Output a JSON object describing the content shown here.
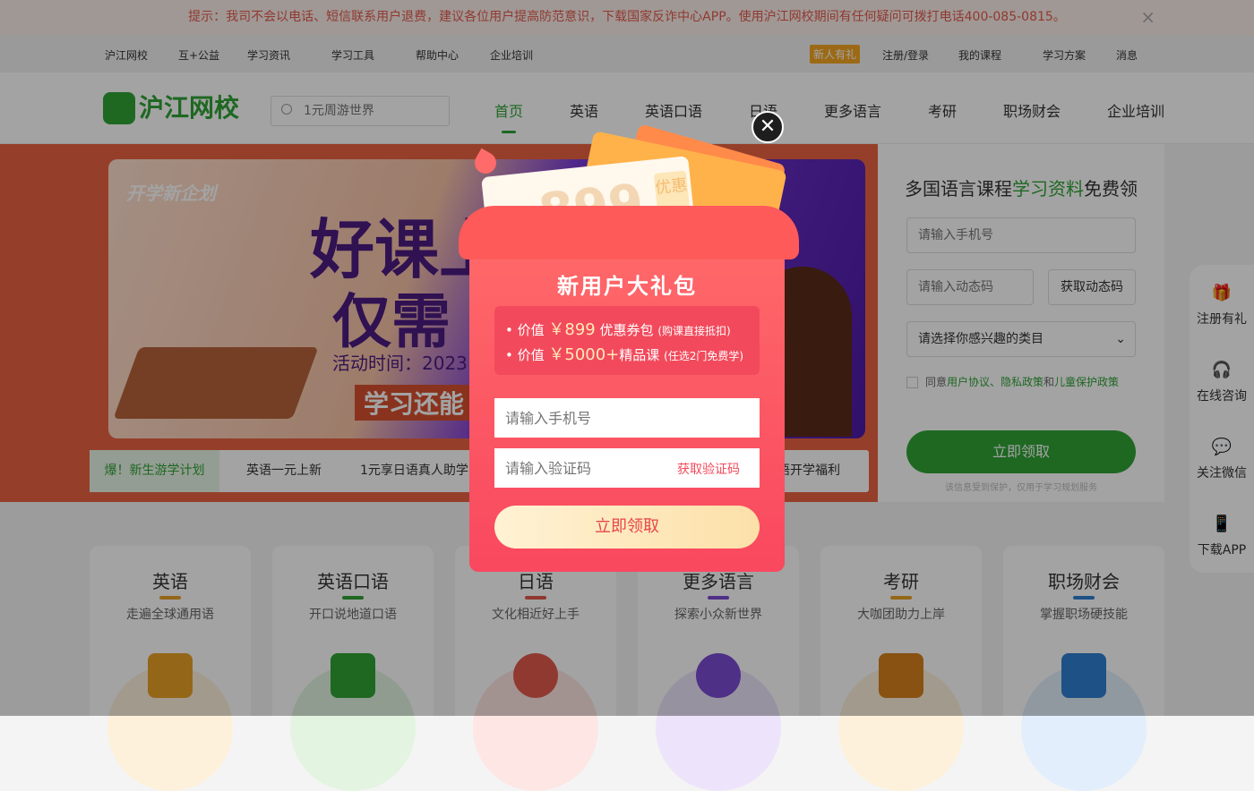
{
  "notice": {
    "text": "提示：我司不会以电话、短信联系用户退费，建议各位用户提高防范意识，下载国家反诈中心APP。使用沪江网校期间有任何疑问可拨打电话400-085-0815。",
    "close_icon": "×"
  },
  "topbar": {
    "left": [
      "沪江网校",
      "互+公益",
      "学习资讯",
      "学习工具",
      "帮助中心",
      "企业培训"
    ],
    "newuser_badge": "新人有礼",
    "login": "注册/登录",
    "my_courses": "我的课程",
    "study_plan": "学习方案",
    "messages": "消息"
  },
  "header": {
    "logo_text": "沪江网校",
    "search_placeholder": "1元周游世界",
    "nav": [
      "首页",
      "英语",
      "英语口语",
      "日语",
      "更多语言",
      "考研",
      "职场财会",
      "企业培训"
    ]
  },
  "banner": {
    "tag": "开学新企划",
    "headline1": "好课上",
    "headline2": "仅需",
    "time": "活动时间：2023",
    "sub": "学习还能",
    "ticker_hot": "爆！新生游学计划",
    "ticker": [
      "英语一元上新",
      "1元享日语真人助学",
      "语开学福利"
    ]
  },
  "form": {
    "title_pre": "多国语言课程",
    "title_hl": "学习资料",
    "title_post": "免费领",
    "phone_placeholder": "请输入手机号",
    "code_placeholder": "请输入动态码",
    "get_code": "获取动态码",
    "category_placeholder": "请选择你感兴趣的类目",
    "agree_pre": "同意",
    "agree_links": "用户协议、隐私政策",
    "agree_and": "和",
    "agree_child": "儿童保护政策",
    "submit": "立即领取",
    "tiny": "该信息受到保护，仅用于学习规划服务"
  },
  "sidebar": [
    {
      "label": "注册有礼",
      "icon": "gift-icon"
    },
    {
      "label": "在线咨询",
      "icon": "headset-icon"
    },
    {
      "label": "关注微信",
      "icon": "wechat-icon"
    },
    {
      "label": "下载APP",
      "icon": "app-icon"
    }
  ],
  "categories": [
    {
      "title": "英语",
      "sub": "走遍全球通用语",
      "color": "#e8a126"
    },
    {
      "title": "英语口语",
      "sub": "开口说地道口语",
      "color": "#2fa336"
    },
    {
      "title": "日语",
      "sub": "文化相近好上手",
      "color": "#e25a4c"
    },
    {
      "title": "更多语言",
      "sub": "探索小众新世界",
      "color": "#7b4bd3"
    },
    {
      "title": "考研",
      "sub": "大咖团助力上岸",
      "color": "#e8a126"
    },
    {
      "title": "职场财会",
      "sub": "掌握职场硬技能",
      "color": "#2f7fd1"
    }
  ],
  "popup": {
    "coupon_amount": "899",
    "coupon_yen": "￥",
    "coupon_tag": "优惠",
    "title": "新用户大礼包",
    "line1_pre": "• 价值",
    "line1_big": "￥899",
    "line1_mid": "优惠券包",
    "line1_small": "(购课直接抵扣)",
    "line2_pre": "• 价值",
    "line2_big": "￥5000+",
    "line2_mid": "精品课",
    "line2_small": "(任选2门免费学)",
    "phone_placeholder": "请输入手机号",
    "code_placeholder": "请输入验证码",
    "get_code": "获取验证码",
    "submit": "立即领取",
    "close_icon": "✕"
  }
}
